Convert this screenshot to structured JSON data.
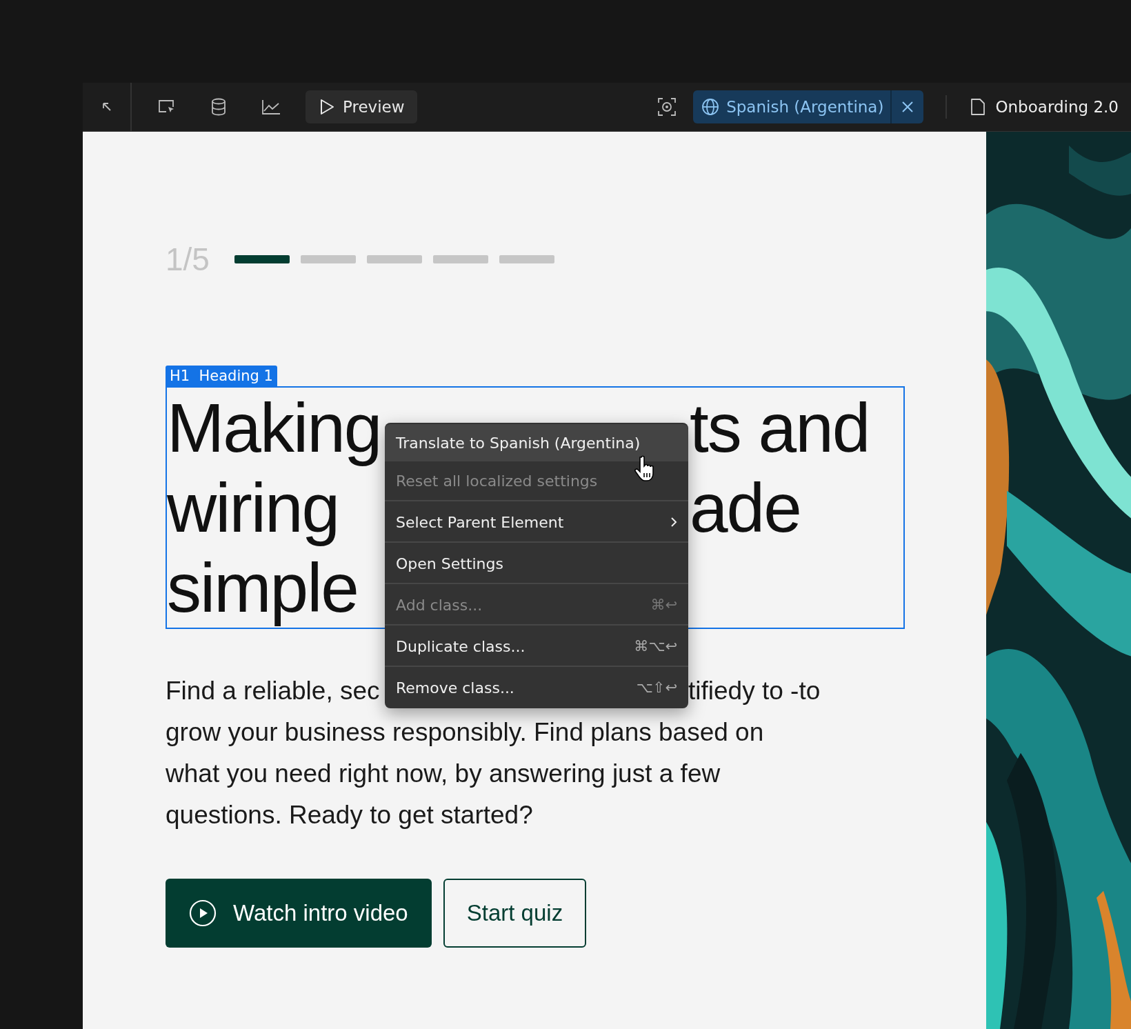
{
  "toolbar": {
    "preview_button": {
      "label": "Preview"
    },
    "locale": {
      "label": "Spanish (Argentina)"
    },
    "page_name": "Onboarding 2.0"
  },
  "progress": {
    "counter": "1/5",
    "steps": [
      {
        "active": true
      },
      {
        "active": false
      },
      {
        "active": false
      },
      {
        "active": false
      },
      {
        "active": false
      }
    ]
  },
  "element_label": {
    "tag": "H1",
    "name": "Heading 1"
  },
  "heading": {
    "lines": [
      {
        "left": "Making",
        "right": "ts and"
      },
      {
        "left": "wiring",
        "right": "ade"
      },
      {
        "left": "simple"
      }
    ]
  },
  "paragraph": {
    "lines": [
      {
        "left": "Find a reliable, sec",
        "right": "tifiedy to -to"
      },
      {
        "left": "grow your business responsibly. Find plans based on"
      },
      {
        "left": "what you need right now, by answering just a few"
      },
      {
        "left": "questions. Ready to get started?"
      }
    ]
  },
  "buttons": [
    {
      "kind": "primary",
      "label": "Watch intro video"
    },
    {
      "kind": "secondary",
      "label": "Start quiz"
    }
  ],
  "context_menu": {
    "items": [
      {
        "label": "Translate to Spanish (Argentina)",
        "highlighted": true,
        "disabled": false,
        "submenu": false,
        "divider_after": false
      },
      {
        "label": "Reset all localized settings",
        "highlighted": false,
        "disabled": true,
        "submenu": false,
        "divider_after": true
      },
      {
        "label": "Select Parent Element",
        "highlighted": false,
        "disabled": false,
        "submenu": true,
        "divider_after": true
      },
      {
        "label": "Open Settings",
        "highlighted": false,
        "disabled": false,
        "submenu": false,
        "divider_after": true
      },
      {
        "label": "Add class...",
        "highlighted": false,
        "disabled": true,
        "submenu": false,
        "divider_after": true,
        "shortcut": "⌘↩"
      },
      {
        "label": "Duplicate class...",
        "highlighted": false,
        "disabled": false,
        "submenu": false,
        "divider_after": true,
        "shortcut": "⌘⌥↩"
      },
      {
        "label": "Remove class...",
        "highlighted": false,
        "disabled": false,
        "submenu": false,
        "divider_after": false,
        "shortcut": "⌥⇧↩"
      }
    ]
  }
}
